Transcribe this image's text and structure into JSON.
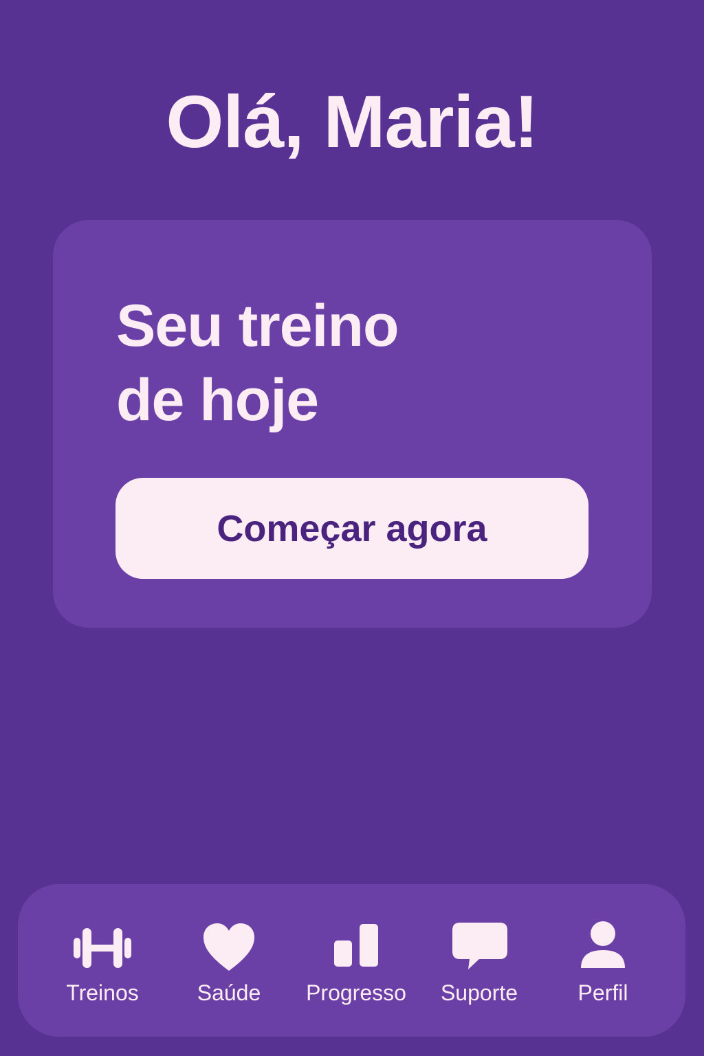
{
  "greeting": "Olá, Maria!",
  "card": {
    "title_line1": "Seu treino",
    "title_line2": "de hoje",
    "button_label": "Começar agora"
  },
  "nav": {
    "items": [
      {
        "label": "Treinos",
        "icon": "dumbbell-icon"
      },
      {
        "label": "Saúde",
        "icon": "heart-icon"
      },
      {
        "label": "Progresso",
        "icon": "bar-chart-icon"
      },
      {
        "label": "Suporte",
        "icon": "chat-bubble-icon"
      },
      {
        "label": "Perfil",
        "icon": "user-icon"
      }
    ]
  },
  "colors": {
    "background": "#573293",
    "card": "#6b40a6",
    "text": "#fcecf4",
    "button_bg": "#fcedf4",
    "button_text": "#4a237f"
  }
}
